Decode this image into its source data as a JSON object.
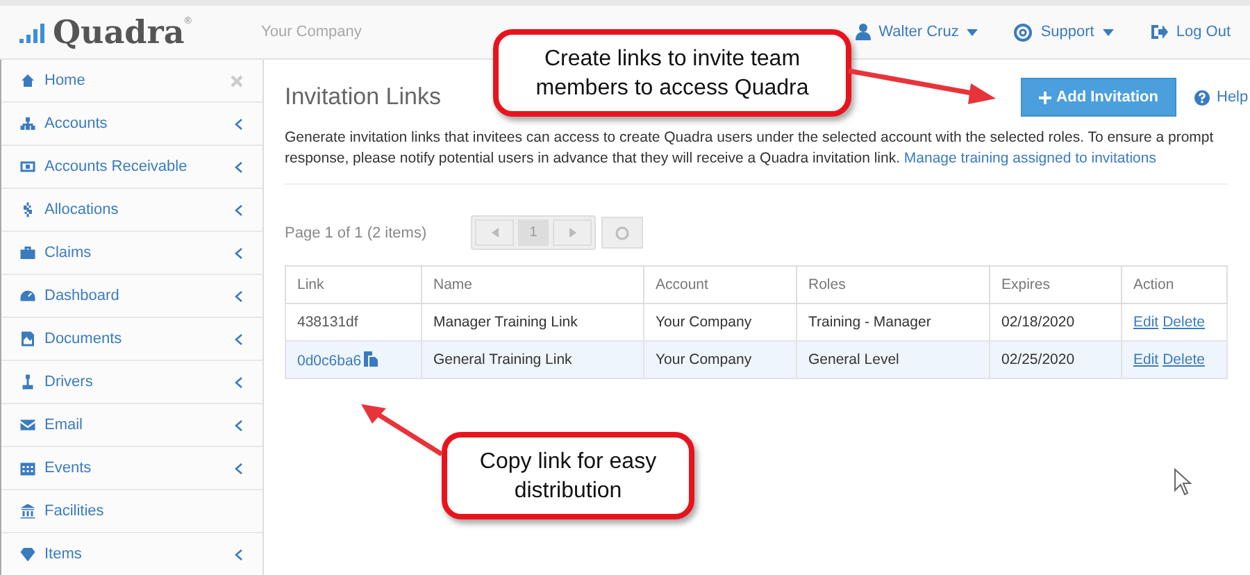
{
  "header": {
    "logo": "Quadra",
    "logo_mark": "®",
    "company": "Your Company",
    "nav": [
      {
        "label": "Walter Cruz",
        "kind": "dropdown"
      },
      {
        "label": "Support",
        "kind": "dropdown"
      },
      {
        "label": "Log Out",
        "kind": "link"
      }
    ]
  },
  "sidebar": {
    "items": [
      {
        "label": "Home",
        "kind": "closable"
      },
      {
        "label": "Accounts",
        "kind": "collapsible"
      },
      {
        "label": "Accounts Receivable",
        "kind": "collapsible"
      },
      {
        "label": "Allocations",
        "kind": "collapsible"
      },
      {
        "label": "Claims",
        "kind": "collapsible"
      },
      {
        "label": "Dashboard",
        "kind": "collapsible"
      },
      {
        "label": "Documents",
        "kind": "collapsible"
      },
      {
        "label": "Drivers",
        "kind": "collapsible"
      },
      {
        "label": "Email",
        "kind": "collapsible"
      },
      {
        "label": "Events",
        "kind": "collapsible"
      },
      {
        "label": "Facilities",
        "kind": "plain"
      },
      {
        "label": "Items",
        "kind": "collapsible"
      }
    ]
  },
  "page": {
    "title": "Invitation Links",
    "add_button": "Add Invitation",
    "help": "Help",
    "description": "Generate invitation links that invitees can access to create Quadra users under the selected account with the selected roles. To ensure a prompt response, please notify potential users in advance that they will receive a Quadra invitation link.",
    "description_link": "Manage training assigned to invitations",
    "pager": {
      "summary": "Page 1 of 1 (2 items)",
      "current": "1"
    },
    "table": {
      "columns": [
        "Link",
        "Name",
        "Account",
        "Roles",
        "Expires",
        "Action"
      ],
      "rows": [
        {
          "selected": false,
          "cells": [
            "438131df",
            "Manager Training Link",
            "Your Company",
            "Training - Manager",
            "02/18/2020"
          ],
          "actions": [
            "Edit",
            "Delete"
          ]
        },
        {
          "selected": true,
          "cells": [
            "0d0c6ba6",
            "General Training Link",
            "Your Company",
            "General Level",
            "02/25/2020"
          ],
          "actions": [
            "Edit",
            "Delete"
          ]
        }
      ]
    }
  },
  "callouts": [
    {
      "text": "Create links to invite team members to access Quadra"
    },
    {
      "text": "Copy link for easy distribution"
    }
  ]
}
